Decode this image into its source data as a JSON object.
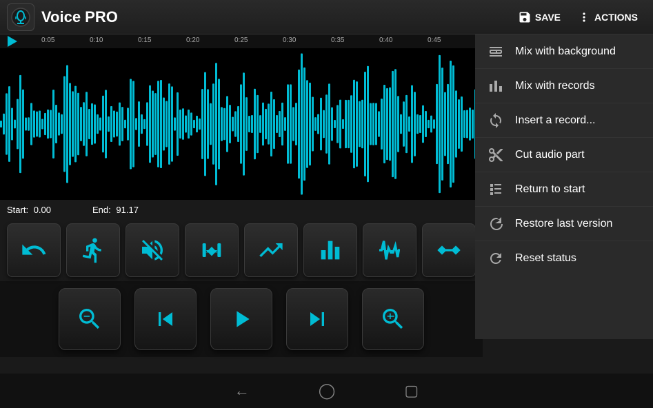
{
  "app": {
    "title": "Voice PRO",
    "save_label": "SAVE",
    "actions_label": "ACTIONS"
  },
  "timeline": {
    "markers": [
      "0:05",
      "0:10",
      "0:15",
      "0:20",
      "0:25",
      "0:30",
      "0:35",
      "0:40",
      "0:45"
    ]
  },
  "position": {
    "start_label": "Start:",
    "start_value": "0.00",
    "end_label": "End:",
    "end_value": "91.17"
  },
  "menu": {
    "items": [
      {
        "id": "mix-bg",
        "label": "Mix with background",
        "icon": "mix-bg-icon"
      },
      {
        "id": "mix-records",
        "label": "Mix with records",
        "icon": "mix-rec-icon"
      },
      {
        "id": "insert-record",
        "label": "Insert a record...",
        "icon": "insert-icon"
      },
      {
        "id": "cut-audio",
        "label": "Cut audio part",
        "icon": "cut-icon"
      },
      {
        "id": "return-start",
        "label": "Return to start",
        "icon": "return-icon"
      },
      {
        "id": "restore-last",
        "label": "Restore last version",
        "icon": "restore-icon"
      },
      {
        "id": "reset-status",
        "label": "Reset status",
        "icon": "reset-icon"
      }
    ]
  },
  "controls": {
    "buttons": [
      {
        "id": "undo",
        "icon": "undo-icon"
      },
      {
        "id": "run",
        "icon": "run-icon"
      },
      {
        "id": "mute",
        "icon": "mute-icon"
      },
      {
        "id": "pitch",
        "icon": "pitch-icon"
      },
      {
        "id": "level",
        "icon": "level-icon"
      },
      {
        "id": "equalizer",
        "icon": "equalizer-icon"
      },
      {
        "id": "waveform",
        "icon": "waveform-icon"
      },
      {
        "id": "trim",
        "icon": "trim-icon"
      }
    ]
  },
  "transport": {
    "buttons": [
      {
        "id": "zoom-out",
        "icon": "zoom-out-icon"
      },
      {
        "id": "skip-back",
        "icon": "skip-back-icon"
      },
      {
        "id": "play",
        "icon": "play-icon"
      },
      {
        "id": "skip-forward",
        "icon": "skip-forward-icon"
      },
      {
        "id": "zoom-in",
        "icon": "zoom-in-icon"
      }
    ]
  },
  "navbar": {
    "back_icon": "nav-back-icon",
    "home_icon": "nav-home-icon",
    "recent_icon": "nav-recent-icon"
  }
}
